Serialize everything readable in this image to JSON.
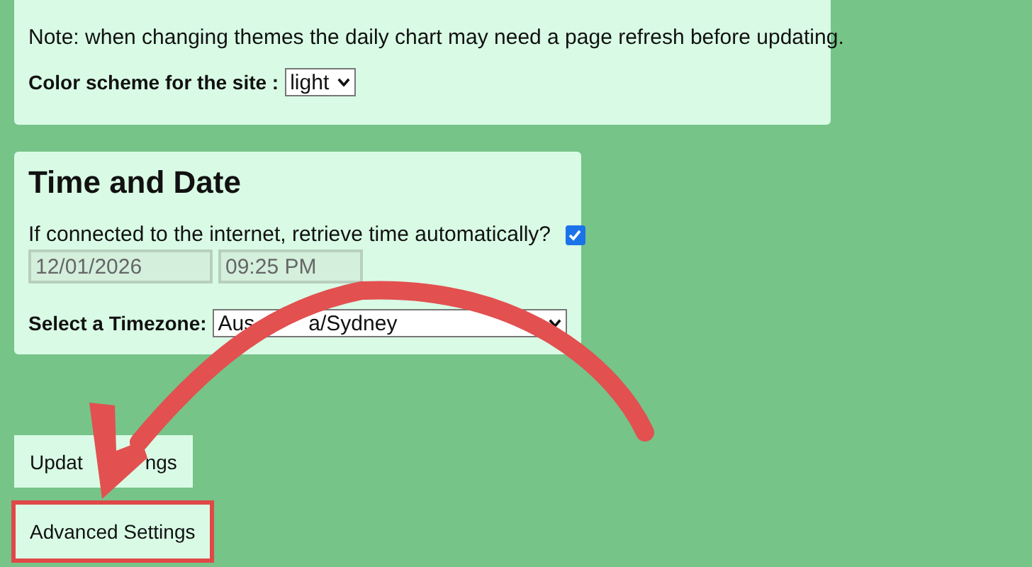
{
  "color_scheme_card": {
    "note": "Note: when changing themes the daily chart may need a page refresh before updating.",
    "scheme_label": "Color scheme for the site :",
    "scheme_value": "light"
  },
  "time_date_card": {
    "heading": "Time and Date",
    "auto_label": "If connected to the internet, retrieve time automatically?",
    "auto_checked": true,
    "date_value": "12/01/2026",
    "time_value": "09:25 PM",
    "timezone_label": "Select a Timezone:",
    "timezone_value_parts": [
      "Aus",
      "a/Sydney"
    ]
  },
  "buttons": [
    {
      "label_parts": [
        "Updat",
        "ngs"
      ],
      "highlighted": false
    },
    {
      "label_parts": [
        "Advanced Settings"
      ],
      "highlighted": true
    }
  ]
}
